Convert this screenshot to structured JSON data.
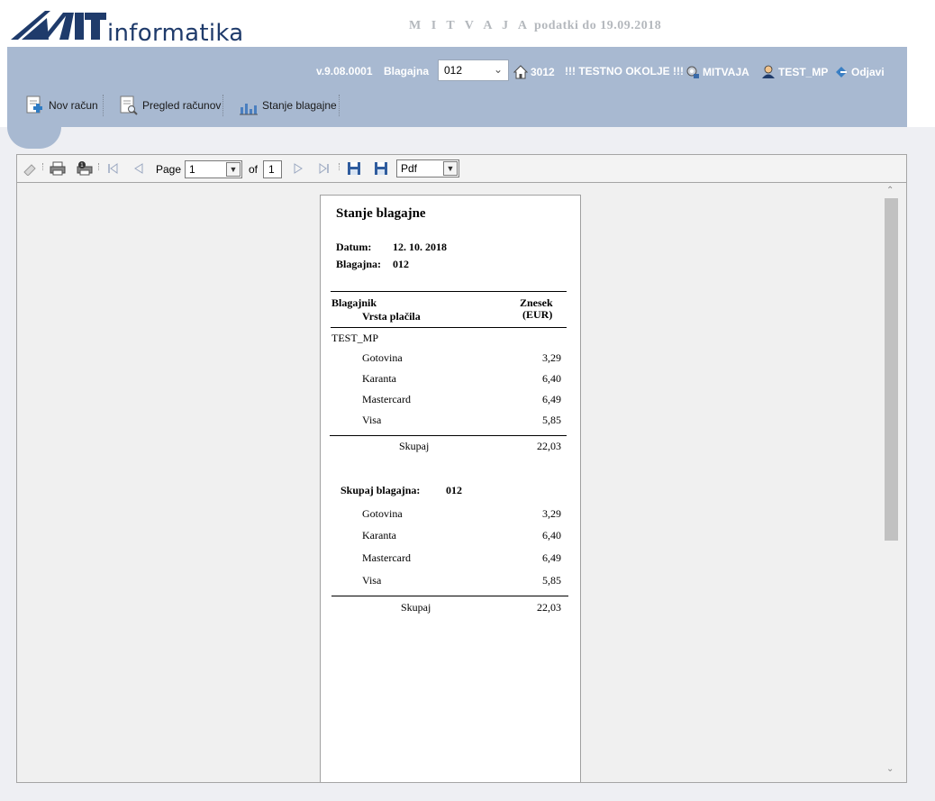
{
  "header": {
    "logo_text": "informatika",
    "title_spaced": "M I T V A J A",
    "title_rest": " podatki do 19.09.2018"
  },
  "status": {
    "version": "v.9.08.0001",
    "blagajna_label": "Blagajna",
    "blagajna_value": "012",
    "store": "3012",
    "env": "!!! TESTNO OKOLJE !!!",
    "company": "MITVAJA",
    "user": "TEST_MP",
    "logout": "Odjavi"
  },
  "menu": {
    "new_invoice": "Nov račun",
    "review": "Pregled računov",
    "balance": "Stanje blagajne"
  },
  "toolbar": {
    "page_label": "Page",
    "page_value": "1",
    "of_label": "of",
    "page_total": "1",
    "format_value": "Pdf"
  },
  "report": {
    "title": "Stanje blagajne",
    "datum_label": "Datum:",
    "datum_value": "12. 10. 2018",
    "blagajna_label": "Blagajna:",
    "blagajna_value": "012",
    "col_cashier": "Blagajnik",
    "col_payment": "Vrsta plačila",
    "col_amount_1": "Znesek",
    "col_amount_2": "(EUR)",
    "cashier_name": "TEST_MP",
    "cashier_rows": [
      {
        "label": "Gotovina",
        "value": "3,29"
      },
      {
        "label": "Karanta",
        "value": "6,40"
      },
      {
        "label": "Mastercard",
        "value": "6,49"
      },
      {
        "label": "Visa",
        "value": "5,85"
      }
    ],
    "cashier_total_label": "Skupaj",
    "cashier_total_value": "22,03",
    "summary_label": "Skupaj blagajna:",
    "summary_value": "012",
    "summary_rows": [
      {
        "label": "Gotovina",
        "value": "3,29"
      },
      {
        "label": "Karanta",
        "value": "6,40"
      },
      {
        "label": "Mastercard",
        "value": "6,49"
      },
      {
        "label": "Visa",
        "value": "5,85"
      }
    ],
    "summary_total_label": "Skupaj",
    "summary_total_value": "22,03"
  },
  "colors": {
    "topbar": "#a8b9d1",
    "logo_blue": "#1f3b6b",
    "background": "#eeeff3"
  },
  "icons": {
    "store": "house-icon",
    "company": "gear-user-icon",
    "user": "user-icon",
    "logout": "logout-icon"
  }
}
